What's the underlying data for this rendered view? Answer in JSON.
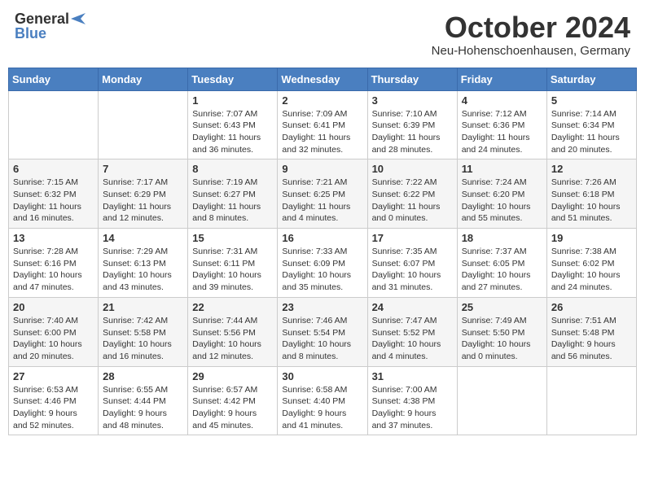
{
  "header": {
    "logo_general": "General",
    "logo_blue": "Blue",
    "month": "October 2024",
    "location": "Neu-Hohenschoenhausen, Germany"
  },
  "weekdays": [
    "Sunday",
    "Monday",
    "Tuesday",
    "Wednesday",
    "Thursday",
    "Friday",
    "Saturday"
  ],
  "weeks": [
    [
      {
        "day": "",
        "info": ""
      },
      {
        "day": "",
        "info": ""
      },
      {
        "day": "1",
        "info": "Sunrise: 7:07 AM\nSunset: 6:43 PM\nDaylight: 11 hours and 36 minutes."
      },
      {
        "day": "2",
        "info": "Sunrise: 7:09 AM\nSunset: 6:41 PM\nDaylight: 11 hours and 32 minutes."
      },
      {
        "day": "3",
        "info": "Sunrise: 7:10 AM\nSunset: 6:39 PM\nDaylight: 11 hours and 28 minutes."
      },
      {
        "day": "4",
        "info": "Sunrise: 7:12 AM\nSunset: 6:36 PM\nDaylight: 11 hours and 24 minutes."
      },
      {
        "day": "5",
        "info": "Sunrise: 7:14 AM\nSunset: 6:34 PM\nDaylight: 11 hours and 20 minutes."
      }
    ],
    [
      {
        "day": "6",
        "info": "Sunrise: 7:15 AM\nSunset: 6:32 PM\nDaylight: 11 hours and 16 minutes."
      },
      {
        "day": "7",
        "info": "Sunrise: 7:17 AM\nSunset: 6:29 PM\nDaylight: 11 hours and 12 minutes."
      },
      {
        "day": "8",
        "info": "Sunrise: 7:19 AM\nSunset: 6:27 PM\nDaylight: 11 hours and 8 minutes."
      },
      {
        "day": "9",
        "info": "Sunrise: 7:21 AM\nSunset: 6:25 PM\nDaylight: 11 hours and 4 minutes."
      },
      {
        "day": "10",
        "info": "Sunrise: 7:22 AM\nSunset: 6:22 PM\nDaylight: 11 hours and 0 minutes."
      },
      {
        "day": "11",
        "info": "Sunrise: 7:24 AM\nSunset: 6:20 PM\nDaylight: 10 hours and 55 minutes."
      },
      {
        "day": "12",
        "info": "Sunrise: 7:26 AM\nSunset: 6:18 PM\nDaylight: 10 hours and 51 minutes."
      }
    ],
    [
      {
        "day": "13",
        "info": "Sunrise: 7:28 AM\nSunset: 6:16 PM\nDaylight: 10 hours and 47 minutes."
      },
      {
        "day": "14",
        "info": "Sunrise: 7:29 AM\nSunset: 6:13 PM\nDaylight: 10 hours and 43 minutes."
      },
      {
        "day": "15",
        "info": "Sunrise: 7:31 AM\nSunset: 6:11 PM\nDaylight: 10 hours and 39 minutes."
      },
      {
        "day": "16",
        "info": "Sunrise: 7:33 AM\nSunset: 6:09 PM\nDaylight: 10 hours and 35 minutes."
      },
      {
        "day": "17",
        "info": "Sunrise: 7:35 AM\nSunset: 6:07 PM\nDaylight: 10 hours and 31 minutes."
      },
      {
        "day": "18",
        "info": "Sunrise: 7:37 AM\nSunset: 6:05 PM\nDaylight: 10 hours and 27 minutes."
      },
      {
        "day": "19",
        "info": "Sunrise: 7:38 AM\nSunset: 6:02 PM\nDaylight: 10 hours and 24 minutes."
      }
    ],
    [
      {
        "day": "20",
        "info": "Sunrise: 7:40 AM\nSunset: 6:00 PM\nDaylight: 10 hours and 20 minutes."
      },
      {
        "day": "21",
        "info": "Sunrise: 7:42 AM\nSunset: 5:58 PM\nDaylight: 10 hours and 16 minutes."
      },
      {
        "day": "22",
        "info": "Sunrise: 7:44 AM\nSunset: 5:56 PM\nDaylight: 10 hours and 12 minutes."
      },
      {
        "day": "23",
        "info": "Sunrise: 7:46 AM\nSunset: 5:54 PM\nDaylight: 10 hours and 8 minutes."
      },
      {
        "day": "24",
        "info": "Sunrise: 7:47 AM\nSunset: 5:52 PM\nDaylight: 10 hours and 4 minutes."
      },
      {
        "day": "25",
        "info": "Sunrise: 7:49 AM\nSunset: 5:50 PM\nDaylight: 10 hours and 0 minutes."
      },
      {
        "day": "26",
        "info": "Sunrise: 7:51 AM\nSunset: 5:48 PM\nDaylight: 9 hours and 56 minutes."
      }
    ],
    [
      {
        "day": "27",
        "info": "Sunrise: 6:53 AM\nSunset: 4:46 PM\nDaylight: 9 hours and 52 minutes."
      },
      {
        "day": "28",
        "info": "Sunrise: 6:55 AM\nSunset: 4:44 PM\nDaylight: 9 hours and 48 minutes."
      },
      {
        "day": "29",
        "info": "Sunrise: 6:57 AM\nSunset: 4:42 PM\nDaylight: 9 hours and 45 minutes."
      },
      {
        "day": "30",
        "info": "Sunrise: 6:58 AM\nSunset: 4:40 PM\nDaylight: 9 hours and 41 minutes."
      },
      {
        "day": "31",
        "info": "Sunrise: 7:00 AM\nSunset: 4:38 PM\nDaylight: 9 hours and 37 minutes."
      },
      {
        "day": "",
        "info": ""
      },
      {
        "day": "",
        "info": ""
      }
    ]
  ]
}
